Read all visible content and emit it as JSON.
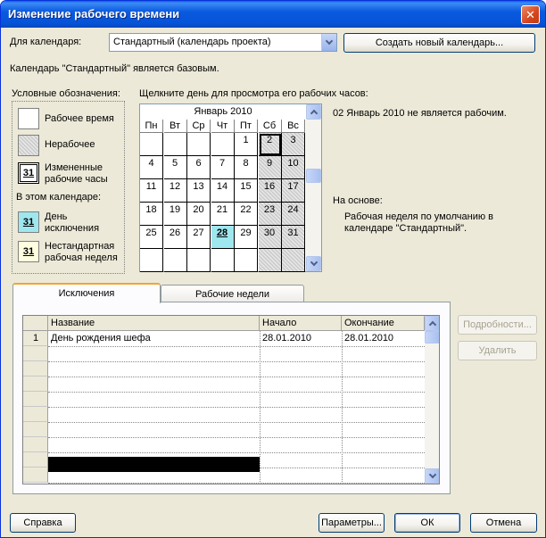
{
  "window": {
    "title": "Изменение рабочего времени"
  },
  "calendar_select": {
    "label": "Для календаря:",
    "value": "Стандартный (календарь проекта)"
  },
  "buttons": {
    "create_calendar": "Создать новый календарь...",
    "help": "Справка",
    "options": "Параметры...",
    "ok": "ОК",
    "cancel": "Отмена",
    "details": "Подробности...",
    "delete": "Удалить"
  },
  "base_info": "Календарь \"Стандартный\" является базовым.",
  "legend": {
    "title": "Условные обозначения:",
    "working": "Рабочее время",
    "nonworking": "Нерабочее",
    "changed": "Измененные рабочие часы",
    "changed_sample": "31",
    "in_calendar": "В этом календаре:",
    "exception": "День исключения",
    "exception_sample": "31",
    "nonstandard": "Нестандартная рабочая неделя",
    "nonstandard_sample": "31"
  },
  "calendar": {
    "prompt": "Щелкните день для просмотра его рабочих часов:",
    "month": "Январь 2010",
    "weekdays": [
      "Пн",
      "Вт",
      "Ср",
      "Чт",
      "Пт",
      "Сб",
      "Вс"
    ],
    "weeks": [
      [
        "",
        "",
        "",
        "",
        "1",
        "2",
        "3"
      ],
      [
        "4",
        "5",
        "6",
        "7",
        "8",
        "9",
        "10"
      ],
      [
        "11",
        "12",
        "13",
        "14",
        "15",
        "16",
        "17"
      ],
      [
        "18",
        "19",
        "20",
        "21",
        "22",
        "23",
        "24"
      ],
      [
        "25",
        "26",
        "27",
        "28",
        "29",
        "30",
        "31"
      ],
      [
        "",
        "",
        "",
        "",
        "",
        "",
        ""
      ]
    ],
    "selected_day": "2",
    "exception_day": "28"
  },
  "day_info": "02 Январь 2010 не является рабочим.",
  "based_on": {
    "label": "На основе:",
    "text": "Рабочая неделя по умолчанию в календаре \"Стандартный\"."
  },
  "tabs": [
    {
      "label": "Исключения",
      "active": true
    },
    {
      "label": "Рабочие недели",
      "active": false
    }
  ],
  "exceptions_table": {
    "columns": [
      "Название",
      "Начало",
      "Окончание"
    ],
    "rows": [
      {
        "num": "1",
        "name": "День рождения шефа",
        "start": "28.01.2010",
        "end": "28.01.2010"
      }
    ]
  }
}
